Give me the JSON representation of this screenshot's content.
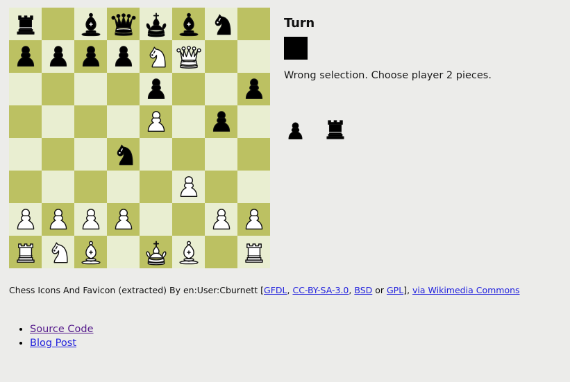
{
  "board": {
    "light_color": "#e9eed1",
    "dark_color": "#bcc162",
    "rows": 8,
    "cols": 8,
    "pieces": [
      [
        "r",
        "",
        "b",
        "q",
        "k",
        "b",
        "n",
        ""
      ],
      [
        "p",
        "p",
        "p",
        "p",
        "N",
        "Q",
        "",
        ""
      ],
      [
        "",
        "",
        "",
        "",
        "p",
        "",
        "",
        "p"
      ],
      [
        "",
        "",
        "",
        "",
        "P",
        "",
        "p",
        ""
      ],
      [
        "",
        "",
        "",
        "n",
        "",
        "",
        "",
        ""
      ],
      [
        "",
        "",
        "",
        "",
        "",
        "P",
        "",
        ""
      ],
      [
        "P",
        "P",
        "P",
        "P",
        "",
        "",
        "P",
        "P"
      ],
      [
        "R",
        "N",
        "B",
        "",
        "K",
        "B",
        "",
        "R"
      ]
    ]
  },
  "panel": {
    "turn_label": "Turn",
    "turn_color": "#000000",
    "turn_player": "black",
    "status_message": "Wrong selection. Choose player 2 pieces.",
    "captured_pieces": [
      "p",
      "r"
    ]
  },
  "attribution": {
    "prefix": "Chess Icons And Favicon (extracted) By en:User:Cburnett [",
    "links": [
      {
        "label": "GFDL",
        "after": ", "
      },
      {
        "label": "CC-BY-SA-3.0",
        "after": ", "
      },
      {
        "label": "BSD",
        "after": " or "
      },
      {
        "label": "GPL",
        "after": "], "
      },
      {
        "label": "via Wikimedia Commons",
        "after": ""
      }
    ]
  },
  "links": [
    {
      "label": "Source Code",
      "state": "visited",
      "color": "#551a8b"
    },
    {
      "label": "Blog Post",
      "state": "unvisited",
      "color": "#2222dd"
    }
  ]
}
